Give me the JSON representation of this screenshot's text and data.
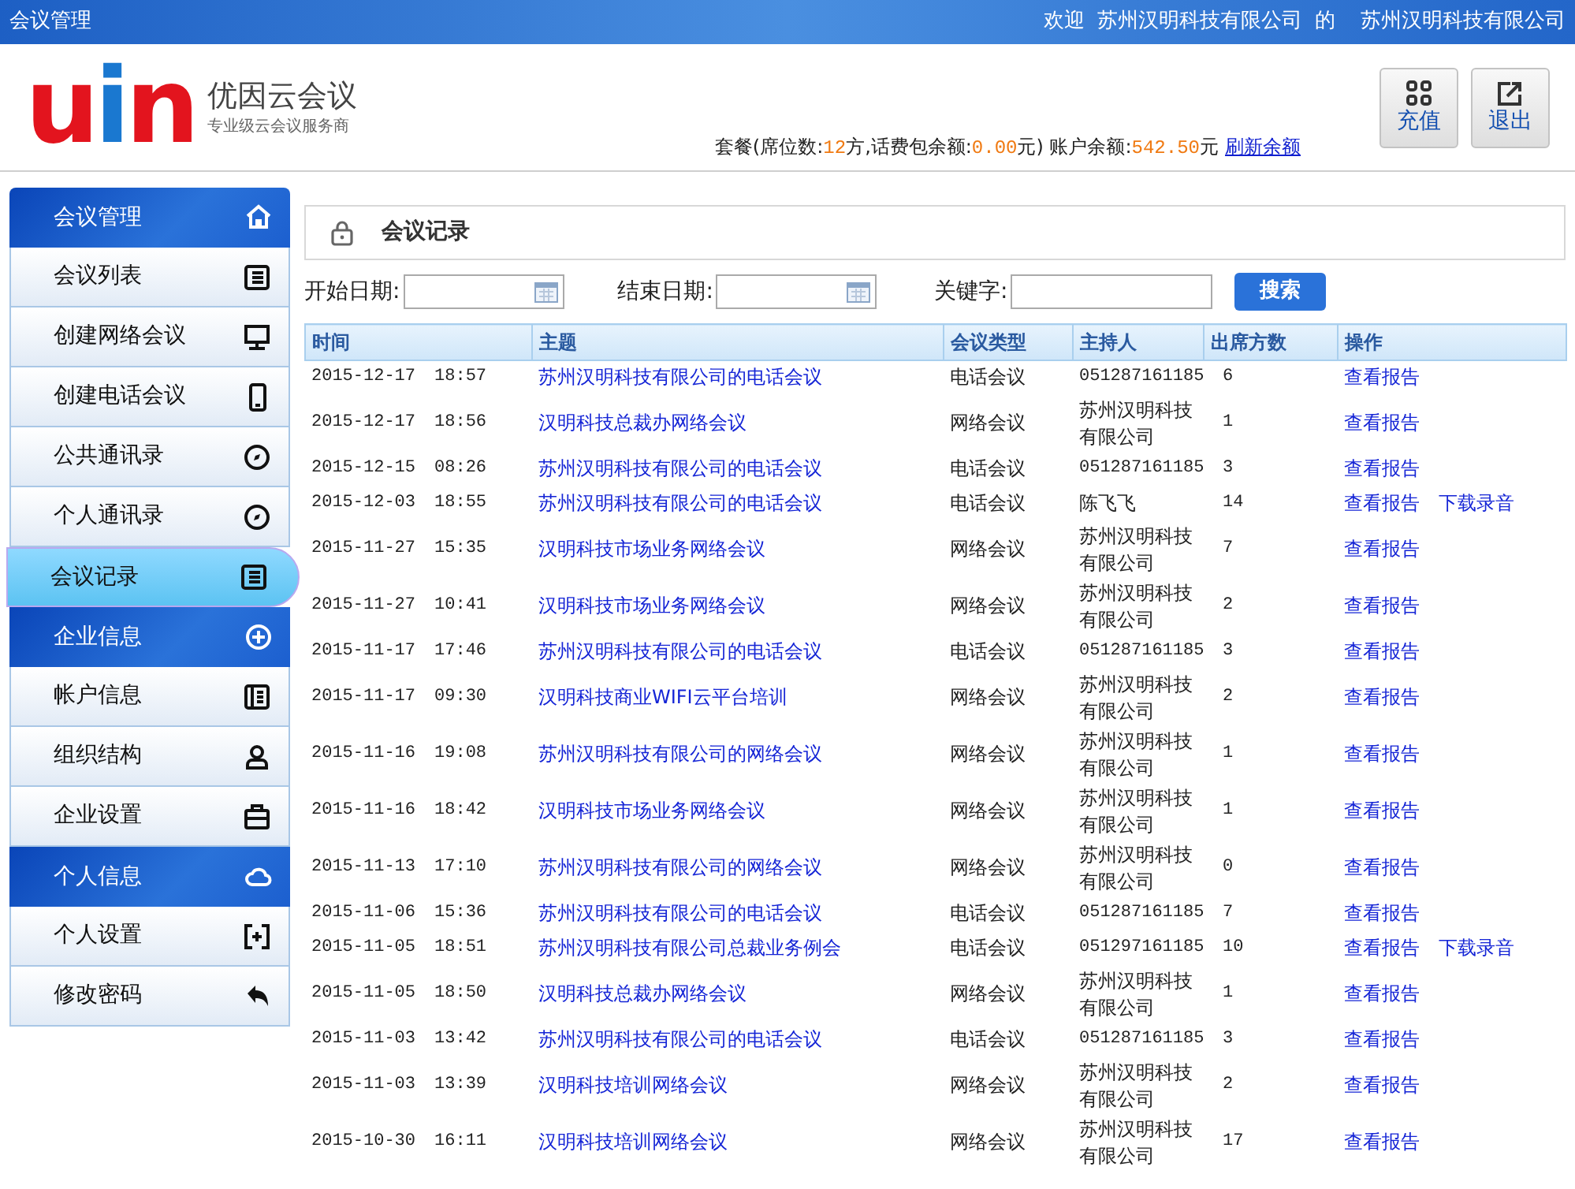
{
  "top_bar": {
    "title": "会议管理",
    "welcome": "欢迎",
    "company": "苏州汉明科技有限公司",
    "of": "的",
    "user": "苏州汉明科技有限公司"
  },
  "logo": {
    "mark": "uin",
    "name": "优因云会议",
    "slogan": "专业级云会议服务商"
  },
  "account": {
    "parts": [
      {
        "text": "套餐(席位数:",
        "kind": "plain"
      },
      {
        "text": "12",
        "kind": "value"
      },
      {
        "text": "方,话费包余额:",
        "kind": "plain"
      },
      {
        "text": "0.00",
        "kind": "value"
      },
      {
        "text": "元) 账户余额:",
        "kind": "plain"
      },
      {
        "text": "542.50",
        "kind": "value"
      },
      {
        "text": "元",
        "kind": "plain"
      }
    ],
    "refresh": "刷新余额"
  },
  "header_buttons": [
    "充值",
    "退出"
  ],
  "sidebar": {
    "items": [
      {
        "kind": "header",
        "label": "会议管理"
      },
      {
        "kind": "item",
        "label": "会议列表",
        "selected": false
      },
      {
        "kind": "item",
        "label": "创建网络会议",
        "selected": false
      },
      {
        "kind": "item",
        "label": "创建电话会议",
        "selected": false
      },
      {
        "kind": "item",
        "label": "公共通讯录",
        "selected": false
      },
      {
        "kind": "item",
        "label": "个人通讯录",
        "selected": false
      },
      {
        "kind": "item",
        "label": "会议记录",
        "selected": true
      },
      {
        "kind": "header",
        "label": "企业信息"
      },
      {
        "kind": "item",
        "label": "帐户信息",
        "selected": false
      },
      {
        "kind": "item",
        "label": "组织结构",
        "selected": false
      },
      {
        "kind": "item",
        "label": "企业设置",
        "selected": false
      },
      {
        "kind": "header",
        "label": "个人信息"
      },
      {
        "kind": "item",
        "label": "个人设置",
        "selected": false
      },
      {
        "kind": "item",
        "label": "修改密码",
        "selected": false
      }
    ]
  },
  "panel": {
    "title": "会议记录"
  },
  "filters": {
    "start_label": "开始日期:",
    "end_label": "结束日期:",
    "keyword_label": "关键字:",
    "search_button": "搜索"
  },
  "table": {
    "columns": [
      "时间",
      "主题",
      "会议类型",
      "主持人",
      "出席方数",
      "操作"
    ],
    "rows": [
      {
        "date": "2015-12-17",
        "time": "18:57",
        "subject": "苏州汉明科技有限公司的电话会议",
        "type": "电话会议",
        "host": "051287161185",
        "count": "6",
        "actions": [
          "查看报告"
        ]
      },
      {
        "date": "2015-12-17",
        "time": "18:56",
        "subject": "汉明科技总裁办网络会议",
        "type": "网络会议",
        "host": "苏州汉明科技有限公司",
        "count": "1",
        "actions": [
          "查看报告"
        ]
      },
      {
        "date": "2015-12-15",
        "time": "08:26",
        "subject": "苏州汉明科技有限公司的电话会议",
        "type": "电话会议",
        "host": "051287161185",
        "count": "3",
        "actions": [
          "查看报告"
        ]
      },
      {
        "date": "2015-12-03",
        "time": "18:55",
        "subject": "苏州汉明科技有限公司的电话会议",
        "type": "电话会议",
        "host": "陈飞飞",
        "count": "14",
        "actions": [
          "查看报告",
          "下载录音"
        ]
      },
      {
        "date": "2015-11-27",
        "time": "15:35",
        "subject": "汉明科技市场业务网络会议",
        "type": "网络会议",
        "host": "苏州汉明科技有限公司",
        "count": "7",
        "actions": [
          "查看报告"
        ]
      },
      {
        "date": "2015-11-27",
        "time": "10:41",
        "subject": "汉明科技市场业务网络会议",
        "type": "网络会议",
        "host": "苏州汉明科技有限公司",
        "count": "2",
        "actions": [
          "查看报告"
        ]
      },
      {
        "date": "2015-11-17",
        "time": "17:46",
        "subject": "苏州汉明科技有限公司的电话会议",
        "type": "电话会议",
        "host": "051287161185",
        "count": "3",
        "actions": [
          "查看报告"
        ]
      },
      {
        "date": "2015-11-17",
        "time": "09:30",
        "subject": "汉明科技商业WIFI云平台培训",
        "type": "网络会议",
        "host": "苏州汉明科技有限公司",
        "count": "2",
        "actions": [
          "查看报告"
        ]
      },
      {
        "date": "2015-11-16",
        "time": "19:08",
        "subject": "苏州汉明科技有限公司的网络会议",
        "type": "网络会议",
        "host": "苏州汉明科技有限公司",
        "count": "1",
        "actions": [
          "查看报告"
        ]
      },
      {
        "date": "2015-11-16",
        "time": "18:42",
        "subject": "汉明科技市场业务网络会议",
        "type": "网络会议",
        "host": "苏州汉明科技有限公司",
        "count": "1",
        "actions": [
          "查看报告"
        ]
      },
      {
        "date": "2015-11-13",
        "time": "17:10",
        "subject": "苏州汉明科技有限公司的网络会议",
        "type": "网络会议",
        "host": "苏州汉明科技有限公司",
        "count": "0",
        "actions": [
          "查看报告"
        ]
      },
      {
        "date": "2015-11-06",
        "time": "15:36",
        "subject": "苏州汉明科技有限公司的电话会议",
        "type": "电话会议",
        "host": "051287161185",
        "count": "7",
        "actions": [
          "查看报告"
        ]
      },
      {
        "date": "2015-11-05",
        "time": "18:51",
        "subject": "苏州汉明科技有限公司总裁业务例会",
        "type": "电话会议",
        "host": "051297161185",
        "count": "10",
        "actions": [
          "查看报告",
          "下载录音"
        ]
      },
      {
        "date": "2015-11-05",
        "time": "18:50",
        "subject": "汉明科技总裁办网络会议",
        "type": "网络会议",
        "host": "苏州汉明科技有限公司",
        "count": "1",
        "actions": [
          "查看报告"
        ]
      },
      {
        "date": "2015-11-03",
        "time": "13:42",
        "subject": "苏州汉明科技有限公司的电话会议",
        "type": "电话会议",
        "host": "051287161185",
        "count": "3",
        "actions": [
          "查看报告"
        ]
      },
      {
        "date": "2015-11-03",
        "time": "13:39",
        "subject": "汉明科技培训网络会议",
        "type": "网络会议",
        "host": "苏州汉明科技有限公司",
        "count": "2",
        "actions": [
          "查看报告"
        ]
      },
      {
        "date": "2015-10-30",
        "time": "16:11",
        "subject": "汉明科技培训网络会议",
        "type": "网络会议",
        "host": "苏州汉明科技有限公司",
        "count": "17",
        "actions": [
          "查看报告"
        ]
      }
    ]
  }
}
